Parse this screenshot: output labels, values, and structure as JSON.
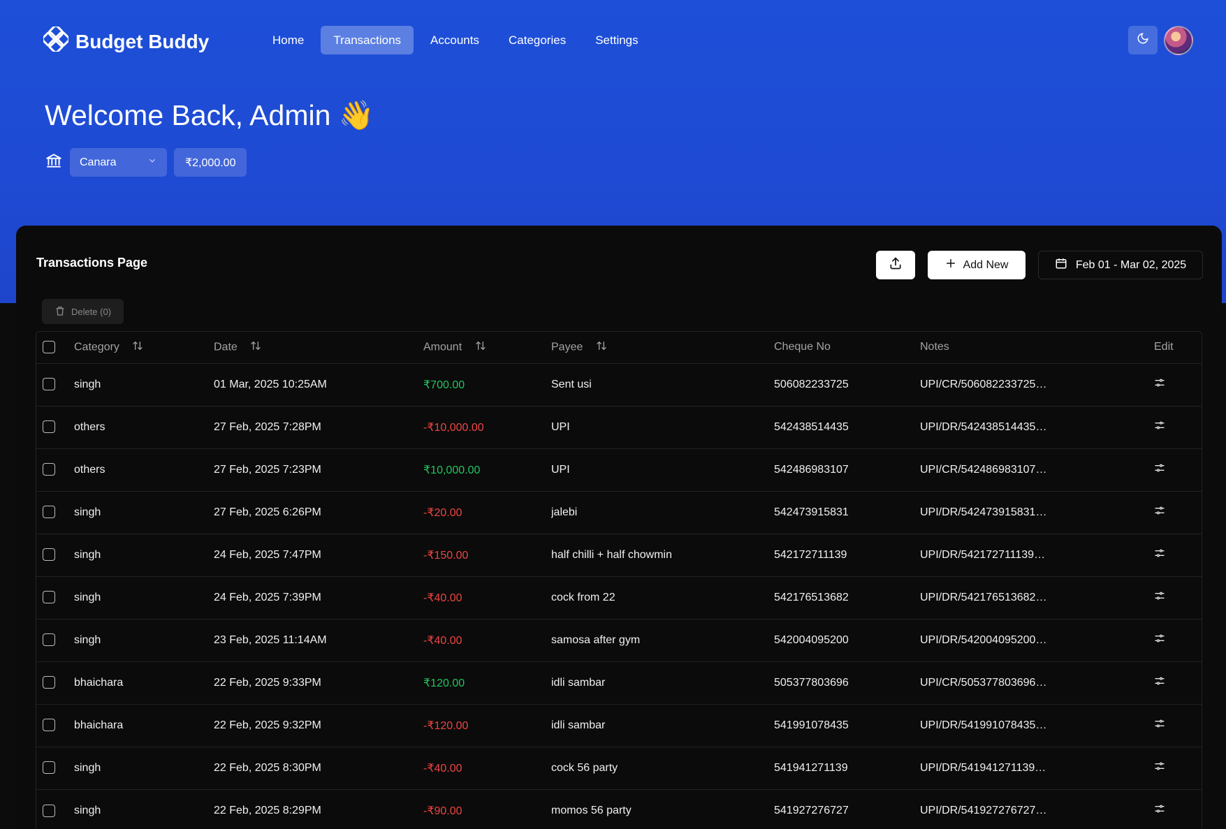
{
  "app": {
    "name": "Budget Buddy",
    "colors": {
      "hero": "#1d4fd8",
      "positive": "#22c55e",
      "negative": "#ef4444"
    }
  },
  "nav": {
    "items": [
      {
        "label": "Home"
      },
      {
        "label": "Transactions",
        "active": true
      },
      {
        "label": "Accounts"
      },
      {
        "label": "Categories"
      },
      {
        "label": "Settings"
      }
    ]
  },
  "header": {
    "welcome": "Welcome Back, Admin 👋",
    "account": "Canara",
    "balance": "₹2,000.00"
  },
  "panel": {
    "title": "Transactions Page",
    "add_label": "Add New",
    "date_range": "Feb 01 - Mar 02, 2025",
    "delete_label": "Delete (0)"
  },
  "table": {
    "columns": [
      "Category",
      "Date",
      "Amount",
      "Payee",
      "Cheque No",
      "Notes",
      "Edit"
    ],
    "rows": [
      {
        "category": "singh",
        "date": "01 Mar, 2025 10:25AM",
        "amount": "₹700.00",
        "type": "pos",
        "payee": "Sent usi",
        "cheque": "506082233725",
        "notes": "UPI/CR/506082233725…"
      },
      {
        "category": "others",
        "date": "27 Feb, 2025 7:28PM",
        "amount": "-₹10,000.00",
        "type": "neg",
        "payee": "UPI",
        "cheque": "542438514435",
        "notes": "UPI/DR/542438514435…"
      },
      {
        "category": "others",
        "date": "27 Feb, 2025 7:23PM",
        "amount": "₹10,000.00",
        "type": "pos",
        "payee": "UPI",
        "cheque": "542486983107",
        "notes": "UPI/CR/542486983107…"
      },
      {
        "category": "singh",
        "date": "27 Feb, 2025 6:26PM",
        "amount": "-₹20.00",
        "type": "neg",
        "payee": "jalebi",
        "cheque": "542473915831",
        "notes": "UPI/DR/542473915831…"
      },
      {
        "category": "singh",
        "date": "24 Feb, 2025 7:47PM",
        "amount": "-₹150.00",
        "type": "neg",
        "payee": "half chilli + half chowmin",
        "cheque": "542172711139",
        "notes": "UPI/DR/542172711139…"
      },
      {
        "category": "singh",
        "date": "24 Feb, 2025 7:39PM",
        "amount": "-₹40.00",
        "type": "neg",
        "payee": "cock from 22",
        "cheque": "542176513682",
        "notes": "UPI/DR/542176513682…"
      },
      {
        "category": "singh",
        "date": "23 Feb, 2025 11:14AM",
        "amount": "-₹40.00",
        "type": "neg",
        "payee": "samosa after gym",
        "cheque": "542004095200",
        "notes": "UPI/DR/542004095200…"
      },
      {
        "category": "bhaichara",
        "date": "22 Feb, 2025 9:33PM",
        "amount": "₹120.00",
        "type": "pos",
        "payee": "idli sambar",
        "cheque": "505377803696",
        "notes": "UPI/CR/505377803696…"
      },
      {
        "category": "bhaichara",
        "date": "22 Feb, 2025 9:32PM",
        "amount": "-₹120.00",
        "type": "neg",
        "payee": "idli sambar",
        "cheque": "541991078435",
        "notes": "UPI/DR/541991078435…"
      },
      {
        "category": "singh",
        "date": "22 Feb, 2025 8:30PM",
        "amount": "-₹40.00",
        "type": "neg",
        "payee": "cock 56 party",
        "cheque": "541941271139",
        "notes": "UPI/DR/541941271139…"
      },
      {
        "category": "singh",
        "date": "22 Feb, 2025 8:29PM",
        "amount": "-₹90.00",
        "type": "neg",
        "payee": "momos 56 party",
        "cheque": "541927276727",
        "notes": "UPI/DR/541927276727…"
      }
    ]
  }
}
